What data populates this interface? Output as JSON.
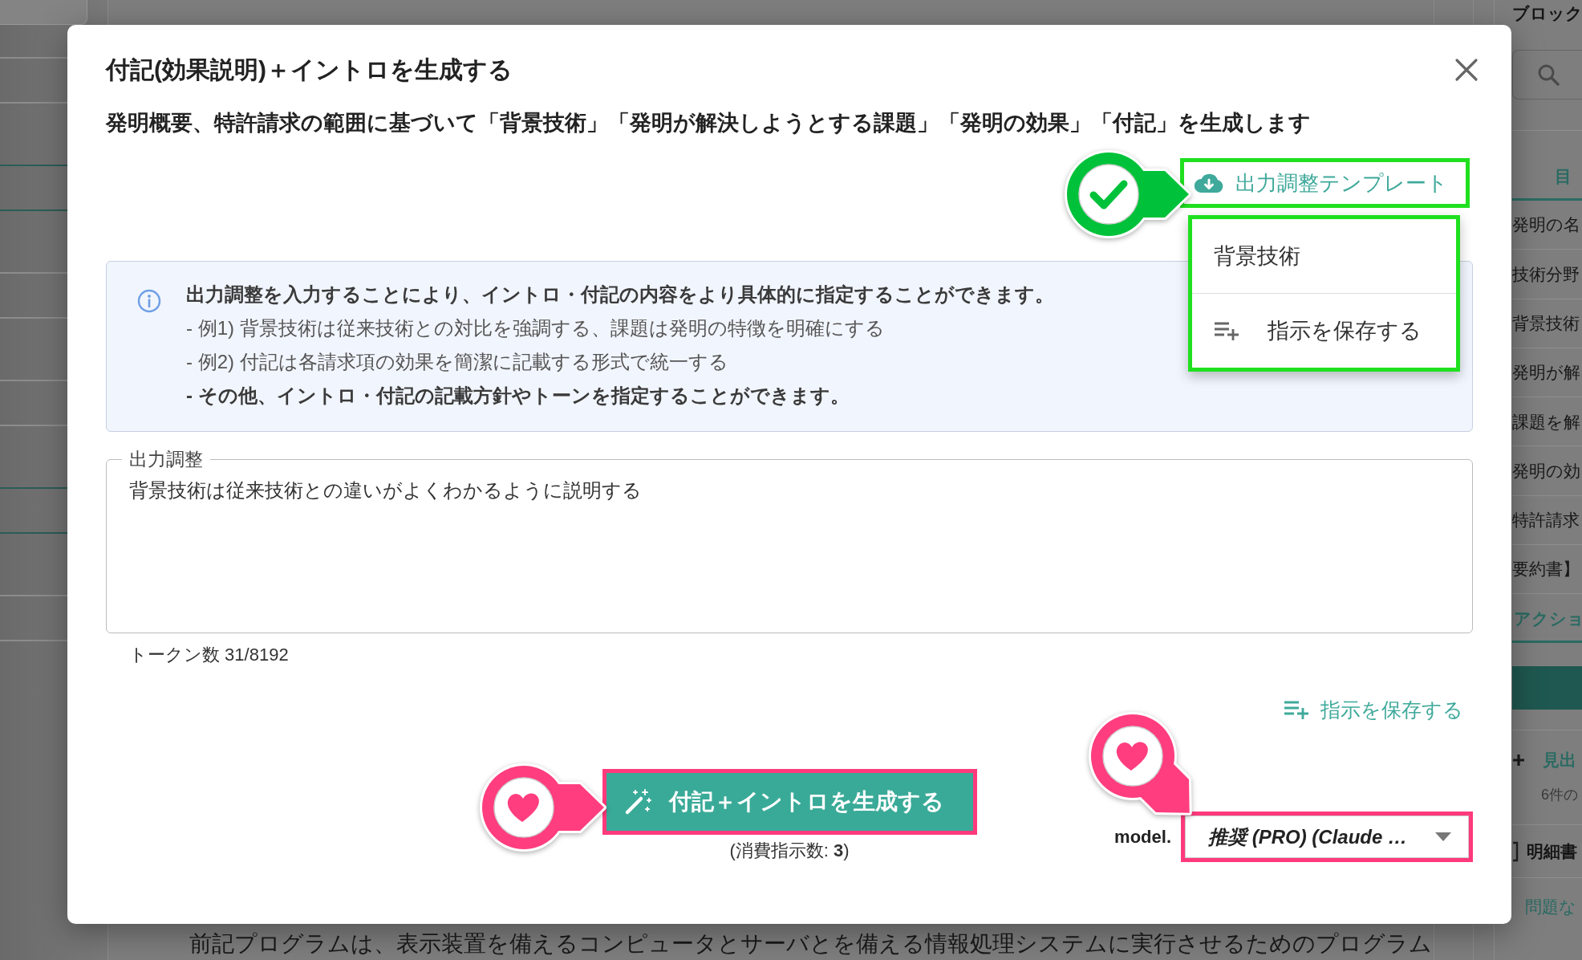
{
  "sidebar": {
    "heading": "ブロック",
    "toc_tab": {
      "label": "目",
      "selected": true
    },
    "toc": [
      "発明の名",
      "技術分野",
      "背景技術",
      "発明が解",
      "課題を解",
      "発明の効",
      "特許請求",
      "要約書】"
    ],
    "action_tab": {
      "label": "アクショ",
      "selected": true
    },
    "actions": [
      {
        "kind": "add",
        "label": "見出",
        "detail": "6件の"
      },
      {
        "kind": "document",
        "label": "明細書"
      },
      {
        "kind": "status",
        "label": "問題な"
      }
    ]
  },
  "document": {
    "text": "前記プログラムは、表示装置を備えるコンピュータとサーバとを備える情報処理システムに実行させるためのプログラム"
  },
  "dialog": {
    "title": "付記(効果説明)＋イントロを生成する",
    "description": "発明概要、特許請求の範囲に基づいて「背景技術」「発明が解決しようとする課題」「発明の効果」「付記」を生成します",
    "template_button": {
      "label": "出力調整テンプレート",
      "highlight": {
        "color": "#1fe01f"
      },
      "marker": {
        "kind": "check",
        "color": "#00c23a"
      }
    },
    "template_menu": {
      "highlight": {
        "color": "#1fe01f"
      },
      "items": [
        {
          "kind": "template",
          "label": "背景技術"
        },
        {
          "kind": "save",
          "label": "指示を保存する"
        }
      ]
    },
    "info": {
      "lines": [
        {
          "text": "出力調整を入力することにより、イントロ・付記の内容をより具体的に指定することができます。",
          "bold": true
        },
        {
          "text": "- 例1) 背景技術は従来技術との対比を強調する、課題は発明の特徴を明確にする",
          "bold": false
        },
        {
          "text": "- 例2) 付記は各請求項の効果を簡潔に記載する形式で統一する",
          "bold": false
        },
        {
          "text": "- その他、イントロ・付記の記載方針やトーンを指定することができます。",
          "bold": true
        }
      ]
    },
    "adjustment": {
      "label": "出力調整",
      "value": "背景技術は従来技術との違いがよくわかるように説明する"
    },
    "token_count": "トークン数 31/8192",
    "save_link": "指示を保存する",
    "generate_button": {
      "label": "付記＋イントロを生成する",
      "highlight": {
        "color": "#ff3a7c"
      },
      "marker": {
        "kind": "heart",
        "color": "#ff3d7f"
      }
    },
    "cost_note": "(消費指示数: **3**)",
    "model": {
      "label": "model.",
      "value": "推奨 (PRO) (Claude …",
      "highlight": {
        "color": "#ff3a7c"
      },
      "marker": {
        "kind": "heart",
        "color": "#ff3d7f"
      }
    }
  }
}
